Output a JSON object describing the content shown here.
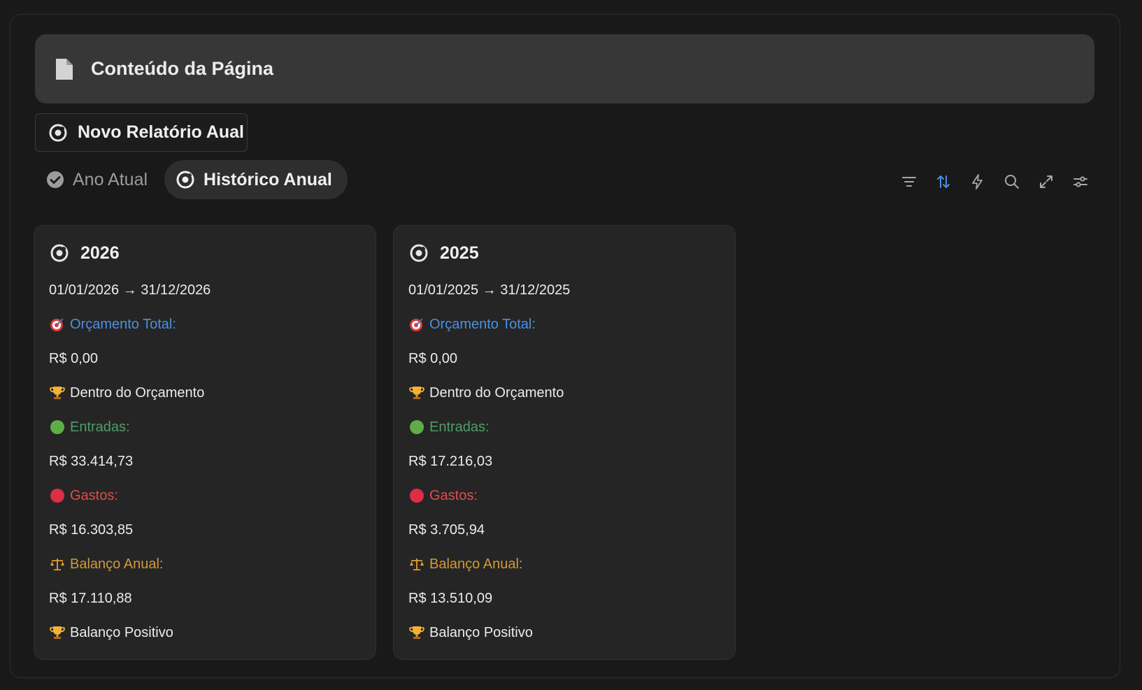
{
  "header": {
    "title": "Conteúdo da Página",
    "icon": "document-icon"
  },
  "new_report": {
    "label": "Novo Relatório Aual",
    "icon": "target-icon"
  },
  "tabs": [
    {
      "label": "Ano Atual",
      "icon": "check-circle-icon",
      "active": false
    },
    {
      "label": "Histórico Anual",
      "icon": "target-icon",
      "active": true
    }
  ],
  "toolbar": [
    "filter-icon",
    "sort-icon",
    "lightning-icon",
    "search-icon",
    "expand-icon",
    "settings-sliders-icon"
  ],
  "colors": {
    "accent_blue": "#4a90e2",
    "green": "#4f9d69",
    "red": "#dd4d4d",
    "orange": "#d29a3a"
  },
  "cards": [
    {
      "year": "2026",
      "date_range": "01/01/2026 → 31/12/2026",
      "budget_label": "Orçamento Total:",
      "budget_value": "R$ 0,00",
      "budget_status": "Dentro do Orçamento",
      "income_label": "Entradas:",
      "income_value": "R$ 33.414,73",
      "expenses_label": "Gastos:",
      "expenses_value": "R$ 16.303,85",
      "balance_label": "Balanço Anual:",
      "balance_value": "R$ 17.110,88",
      "balance_status": "Balanço Positivo"
    },
    {
      "year": "2025",
      "date_range": "01/01/2025 → 31/12/2025",
      "budget_label": "Orçamento Total:",
      "budget_value": "R$ 0,00",
      "budget_status": "Dentro do Orçamento",
      "income_label": "Entradas:",
      "income_value": "R$ 17.216,03",
      "expenses_label": "Gastos:",
      "expenses_value": "R$ 3.705,94",
      "balance_label": "Balanço Anual:",
      "balance_value": "R$ 13.510,09",
      "balance_status": "Balanço Positivo"
    }
  ]
}
